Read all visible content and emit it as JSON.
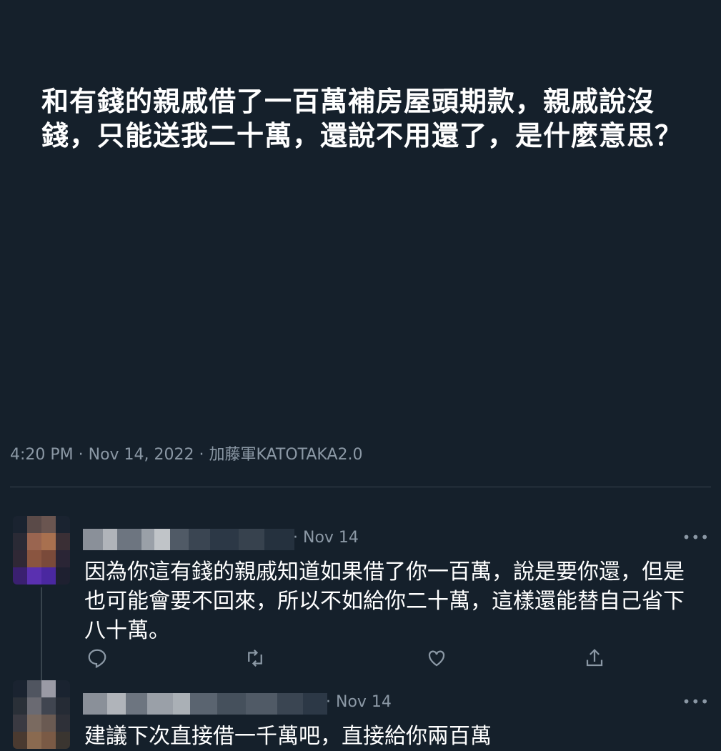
{
  "tweet": {
    "text": "和有錢的親戚借了一百萬補房屋頭期款，親戚說沒錢，只能送我二十萬，還說不用還了，是什麼意思？",
    "meta": "4:20 PM · Nov 14, 2022 · 加藤軍KATOTAKA2.0"
  },
  "replies": [
    {
      "date": "· Nov 14",
      "more": "•••",
      "text": "因為你這有錢的親戚知道如果借了你一百萬，說是要你還，但是也可能會要不回來，所以不如給你二十萬，這樣還能替自己省下八十萬。",
      "actions": [
        "reply-icon",
        "retweet-icon",
        "like-icon",
        "share-icon"
      ]
    },
    {
      "date": "· Nov 14",
      "more": "•••",
      "text": "建議下次直接借一千萬吧，直接給你兩百萬"
    }
  ]
}
